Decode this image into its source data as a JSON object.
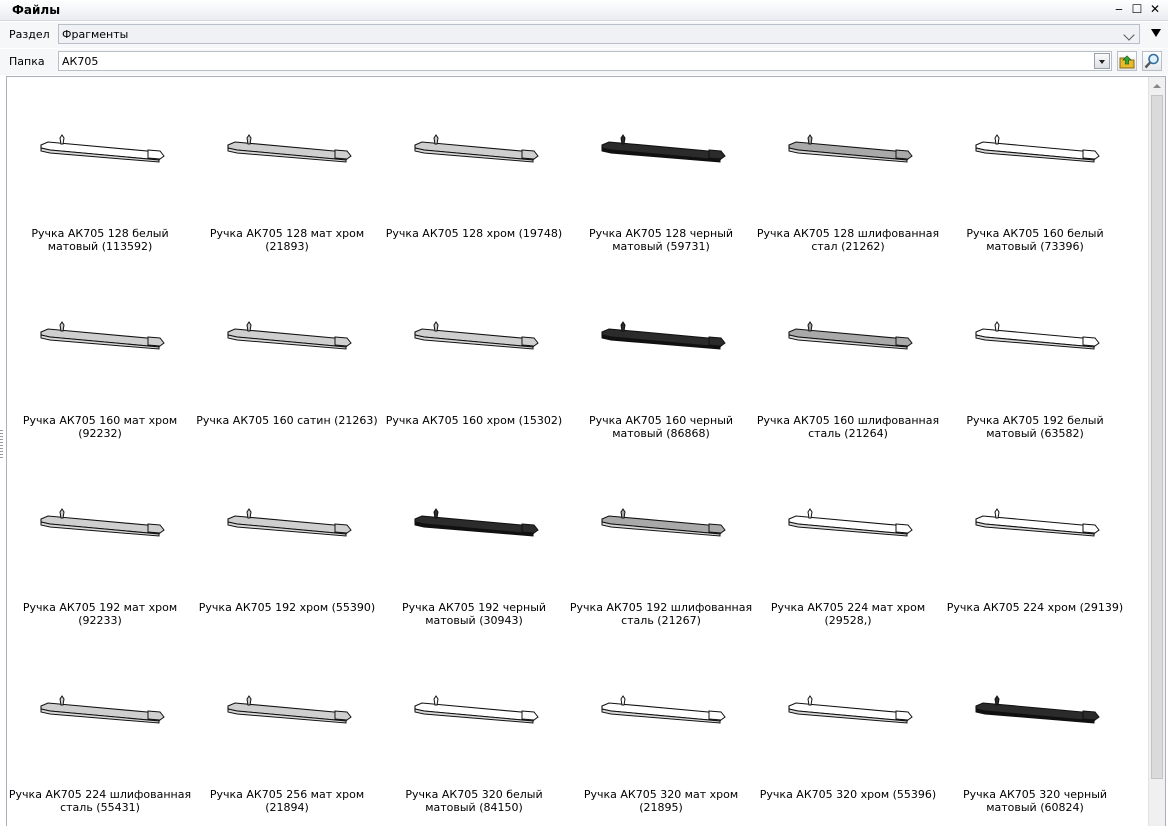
{
  "window": {
    "title": "Файлы"
  },
  "controls": {
    "minimize": "‒",
    "maximize": "☐",
    "close": "✕"
  },
  "section": {
    "label": "Раздел",
    "value": "Фрагменты"
  },
  "folder": {
    "label": "Папка",
    "value": "АК705"
  },
  "colors": {
    "white": "#ffffff",
    "chrome": "#cfcfcf",
    "steel": "#a9a9a9",
    "black": "#2b2b2b"
  },
  "items": [
    {
      "caption": "Ручка АК705 128 белый матовый (113592)",
      "finish": "white"
    },
    {
      "caption": "Ручка АК705 128 мат хром (21893)",
      "finish": "chrome"
    },
    {
      "caption": "Ручка АК705 128 хром (19748)",
      "finish": "chrome"
    },
    {
      "caption": "Ручка АК705 128 черный матовый (59731)",
      "finish": "black"
    },
    {
      "caption": "Ручка АК705 128 шлифованная стал (21262)",
      "finish": "steel"
    },
    {
      "caption": "Ручка АК705 160 белый матовый (73396)",
      "finish": "white"
    },
    {
      "caption": "Ручка АК705 160 мат хром (92232)",
      "finish": "chrome"
    },
    {
      "caption": "Ручка АК705 160 сатин (21263)",
      "finish": "chrome"
    },
    {
      "caption": "Ручка АК705 160 хром (15302)",
      "finish": "chrome"
    },
    {
      "caption": "Ручка АК705 160 черный матовый (86868)",
      "finish": "black"
    },
    {
      "caption": "Ручка АК705 160 шлифованная сталь (21264)",
      "finish": "steel"
    },
    {
      "caption": "Ручка АК705 192 белый матовый (63582)",
      "finish": "white"
    },
    {
      "caption": "Ручка АК705 192 мат хром (92233)",
      "finish": "chrome"
    },
    {
      "caption": "Ручка АК705 192 хром (55390)",
      "finish": "chrome"
    },
    {
      "caption": "Ручка АК705 192 черный матовый (30943)",
      "finish": "black"
    },
    {
      "caption": "Ручка АК705 192 шлифованная сталь (21267)",
      "finish": "steel"
    },
    {
      "caption": "Ручка АК705 224 мат хром (29528,)",
      "finish": "white"
    },
    {
      "caption": "Ручка АК705 224 хром (29139)",
      "finish": "white"
    },
    {
      "caption": "Ручка АК705 224 шлифованная сталь (55431)",
      "finish": "chrome"
    },
    {
      "caption": "Ручка АК705 256 мат хром (21894)",
      "finish": "chrome"
    },
    {
      "caption": "Ручка АК705 320 белый матовый (84150)",
      "finish": "white"
    },
    {
      "caption": "Ручка АК705 320 мат хром (21895)",
      "finish": "white"
    },
    {
      "caption": "Ручка АК705 320 хром (55396)",
      "finish": "white"
    },
    {
      "caption": "Ручка АК705 320 черный матовый (60824)",
      "finish": "black"
    }
  ]
}
